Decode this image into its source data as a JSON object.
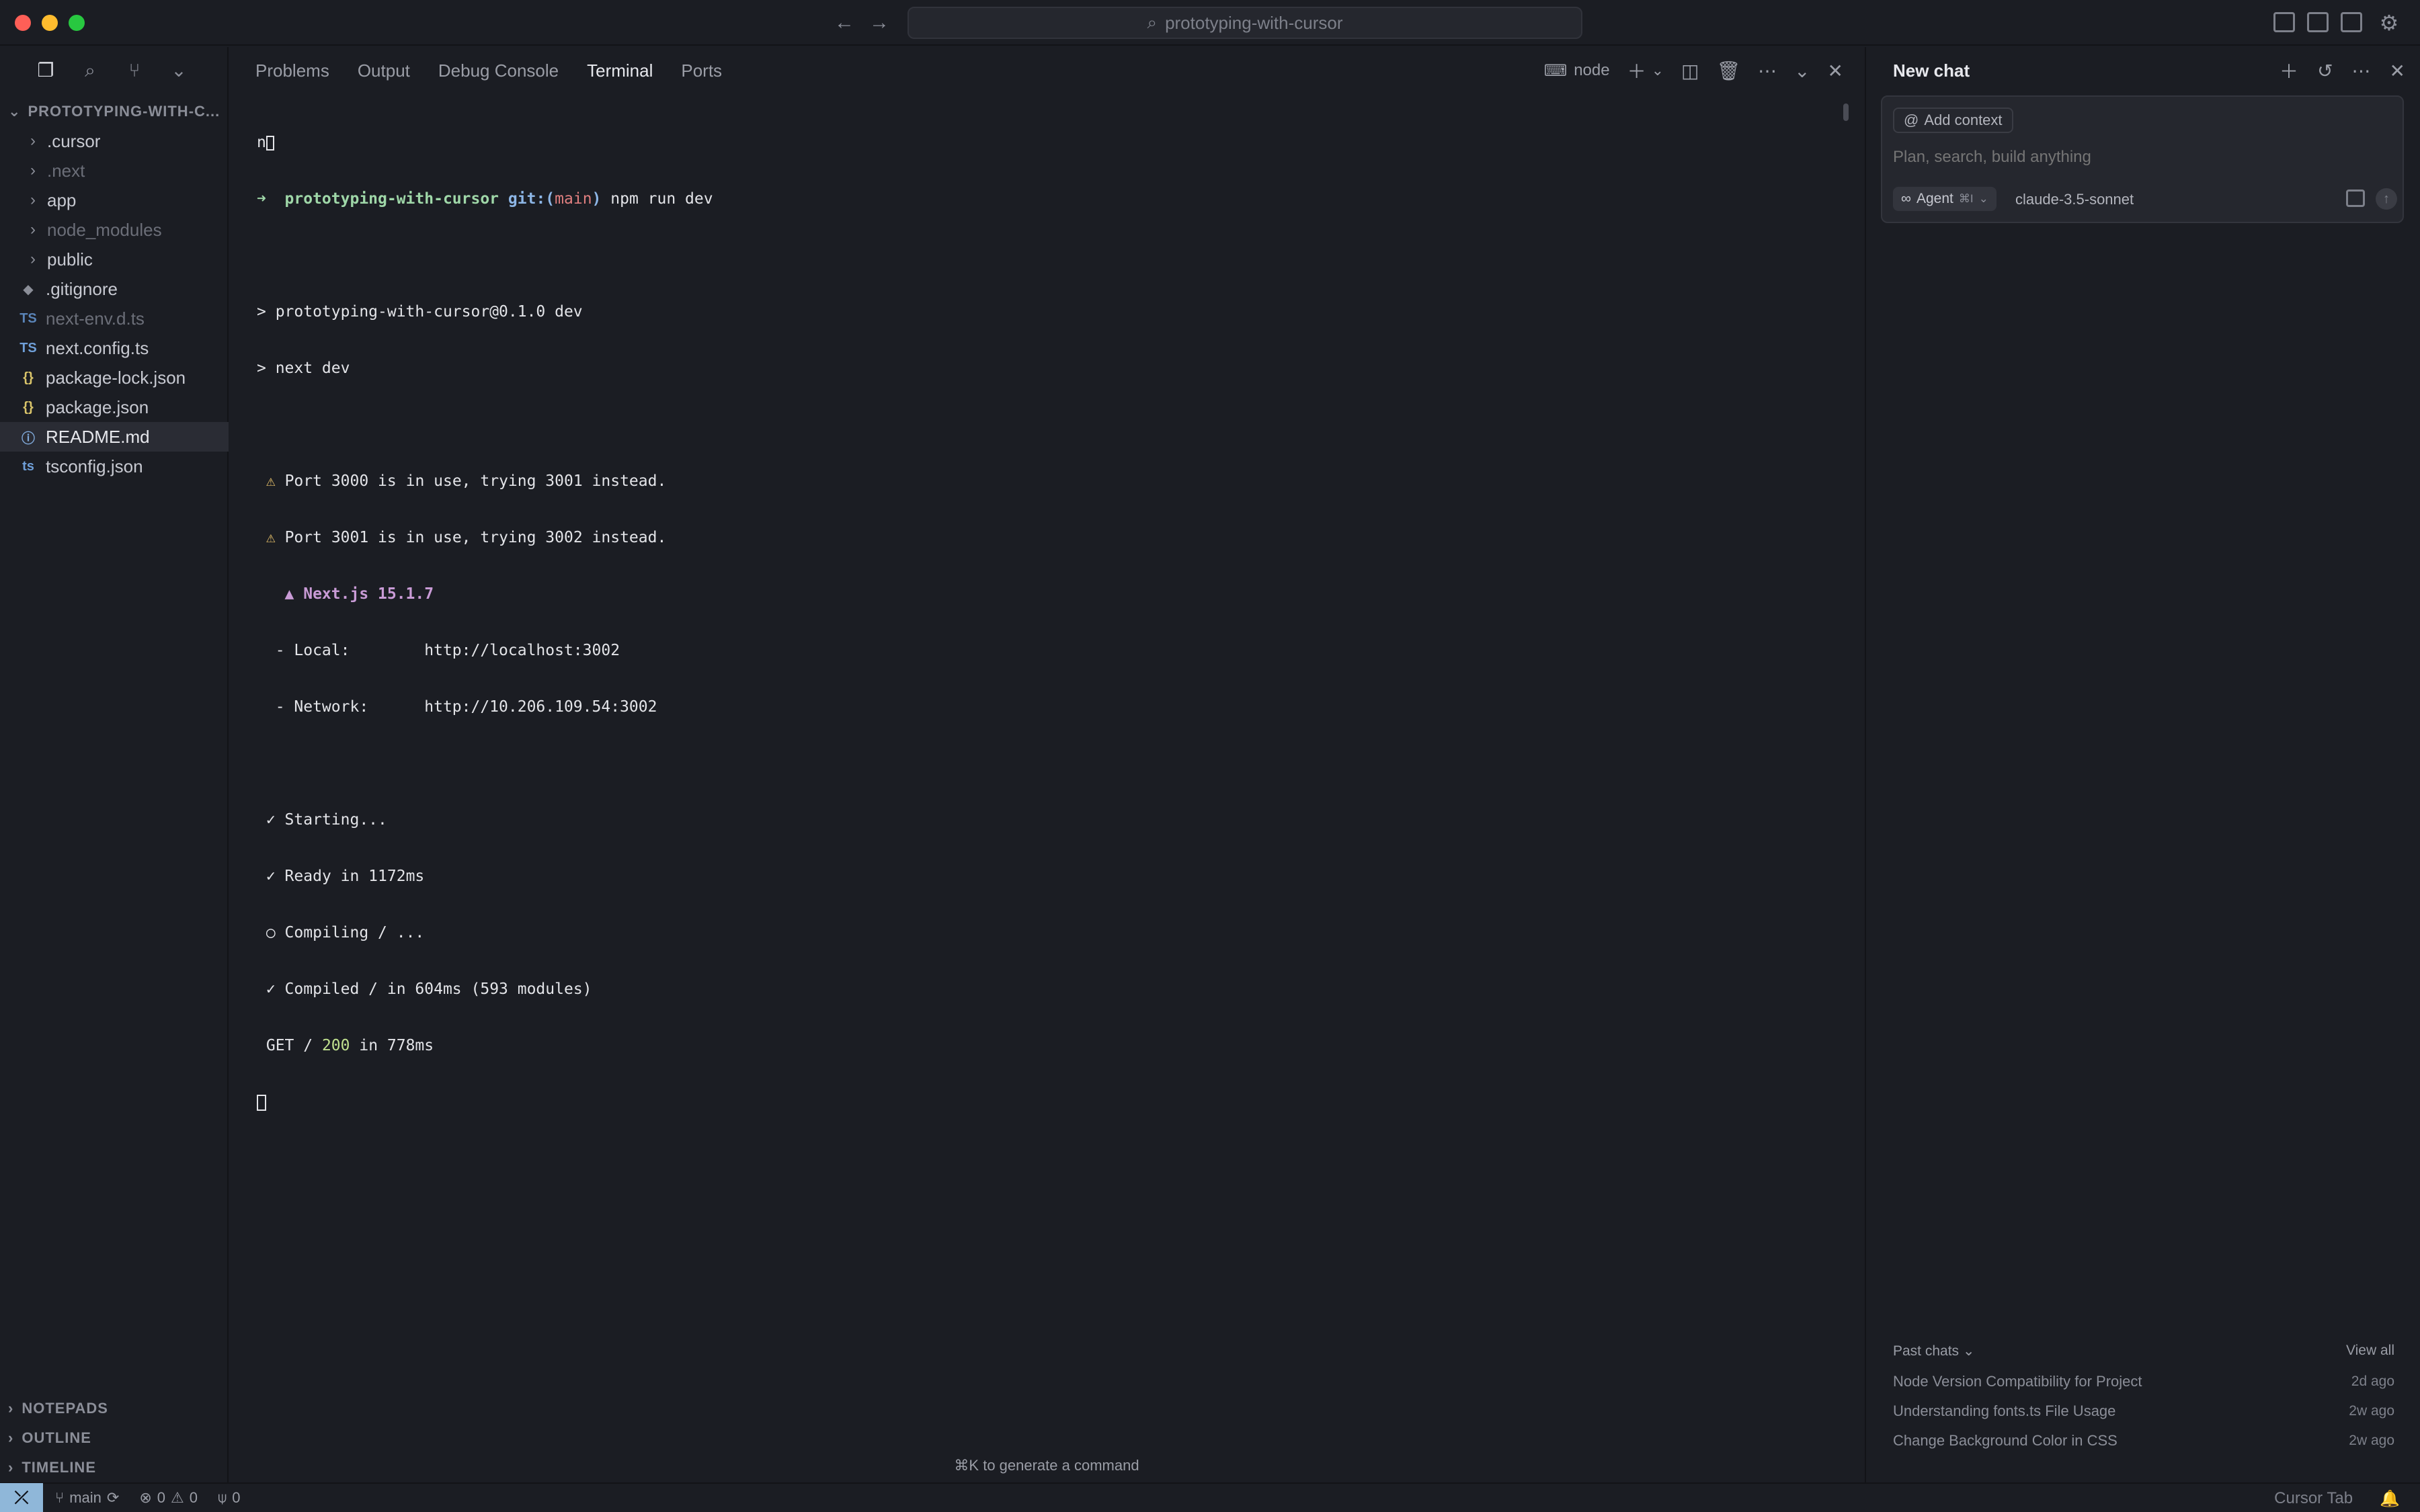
{
  "window": {
    "command_center": "prototyping-with-cursor"
  },
  "sidebar": {
    "root_label": "PROTOTYPING-WITH-C...",
    "items": [
      {
        "label": ".cursor",
        "kind": "folder",
        "dim": false
      },
      {
        "label": ".next",
        "kind": "folder",
        "dim": true
      },
      {
        "label": "app",
        "kind": "folder",
        "dim": false
      },
      {
        "label": "node_modules",
        "kind": "folder",
        "dim": true
      },
      {
        "label": "public",
        "kind": "folder",
        "dim": false
      },
      {
        "label": ".gitignore",
        "kind": "file",
        "icon": "◆",
        "dim": false
      },
      {
        "label": "next-env.d.ts",
        "kind": "file",
        "icon": "TS",
        "dim": true
      },
      {
        "label": "next.config.ts",
        "kind": "file",
        "icon": "TS",
        "dim": false
      },
      {
        "label": "package-lock.json",
        "kind": "file",
        "icon": "{}",
        "dim": false
      },
      {
        "label": "package.json",
        "kind": "file",
        "icon": "{}",
        "dim": false
      },
      {
        "label": "README.md",
        "kind": "file",
        "icon": "ⓘ",
        "dim": false
      },
      {
        "label": "tsconfig.json",
        "kind": "file",
        "icon": "ts",
        "dim": false
      }
    ],
    "sections": [
      "NOTEPADS",
      "OUTLINE",
      "TIMELINE"
    ]
  },
  "panel": {
    "tabs": [
      "Problems",
      "Output",
      "Debug Console",
      "Terminal",
      "Ports"
    ],
    "active_tab": "Terminal",
    "terminal_name": "node",
    "hint": "⌘K to generate a command"
  },
  "terminal": {
    "first_line": "n",
    "prompt_dir": "prototyping-with-cursor",
    "prompt_git": "git:(",
    "prompt_branch": "main",
    "prompt_close": ")",
    "command": "npm run dev",
    "lines": [
      "> prototyping-with-cursor@0.1.0 dev",
      "> next dev"
    ],
    "warn1": "Port 3000 is in use, trying 3001 instead.",
    "warn2": "Port 3001 is in use, trying 3002 instead.",
    "next_label": "▲ Next.js 15.1.7",
    "local": "  - Local:        http://localhost:3002",
    "network": "  - Network:      http://10.206.109.54:3002",
    "starting": "✓ Starting...",
    "ready": "✓ Ready in 1172ms",
    "compiling": "○ Compiling / ...",
    "compiled": "✓ Compiled / in 604ms (593 modules)",
    "get_prefix": "GET / ",
    "get_status": "200",
    "get_suffix": " in 778ms"
  },
  "chat": {
    "title": "New chat",
    "add_context": "Add context",
    "placeholder": "Plan, search, build anything",
    "mode": "Agent",
    "mode_shortcut": "⌘I",
    "model": "claude-3.5-sonnet",
    "past_chats_label": "Past chats",
    "view_all": "View all",
    "past_chats": [
      {
        "title": "Node Version Compatibility for Project",
        "age": "2d ago"
      },
      {
        "title": "Understanding fonts.ts File Usage",
        "age": "2w ago"
      },
      {
        "title": "Change Background Color in CSS",
        "age": "2w ago"
      }
    ]
  },
  "statusbar": {
    "branch": "main",
    "errors": "0",
    "warnings": "0",
    "ports": "0",
    "right_label": "Cursor Tab"
  }
}
